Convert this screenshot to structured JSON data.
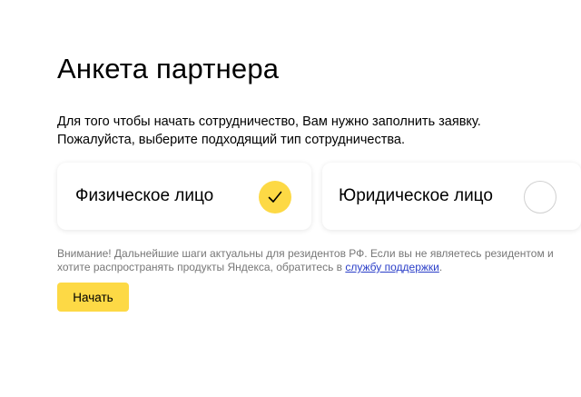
{
  "page": {
    "title": "Анкета партнера",
    "intro_line1": "Для того чтобы начать сотрудничество, Вам нужно заполнить заявку.",
    "intro_line2": "Пожалуйста, выберите подходящий тип сотрудничества."
  },
  "options": [
    {
      "label": "Физическое лицо",
      "selected": true,
      "icon": "check-icon"
    },
    {
      "label": "Юридическое лицо",
      "selected": false,
      "icon": "empty-radio-icon"
    }
  ],
  "notice": {
    "text_before": "Внимание! Дальнейшие шаги актуальны для резидентов РФ. Если вы не являетесь резидентом и хотите распространять продукты Яндекса, обратитесь в ",
    "link_text": "службу поддержки",
    "text_after": "."
  },
  "actions": {
    "start_label": "Начать"
  },
  "colors": {
    "accent": "#fdd945",
    "link": "#2a3ec8",
    "notice_text": "#777777"
  }
}
